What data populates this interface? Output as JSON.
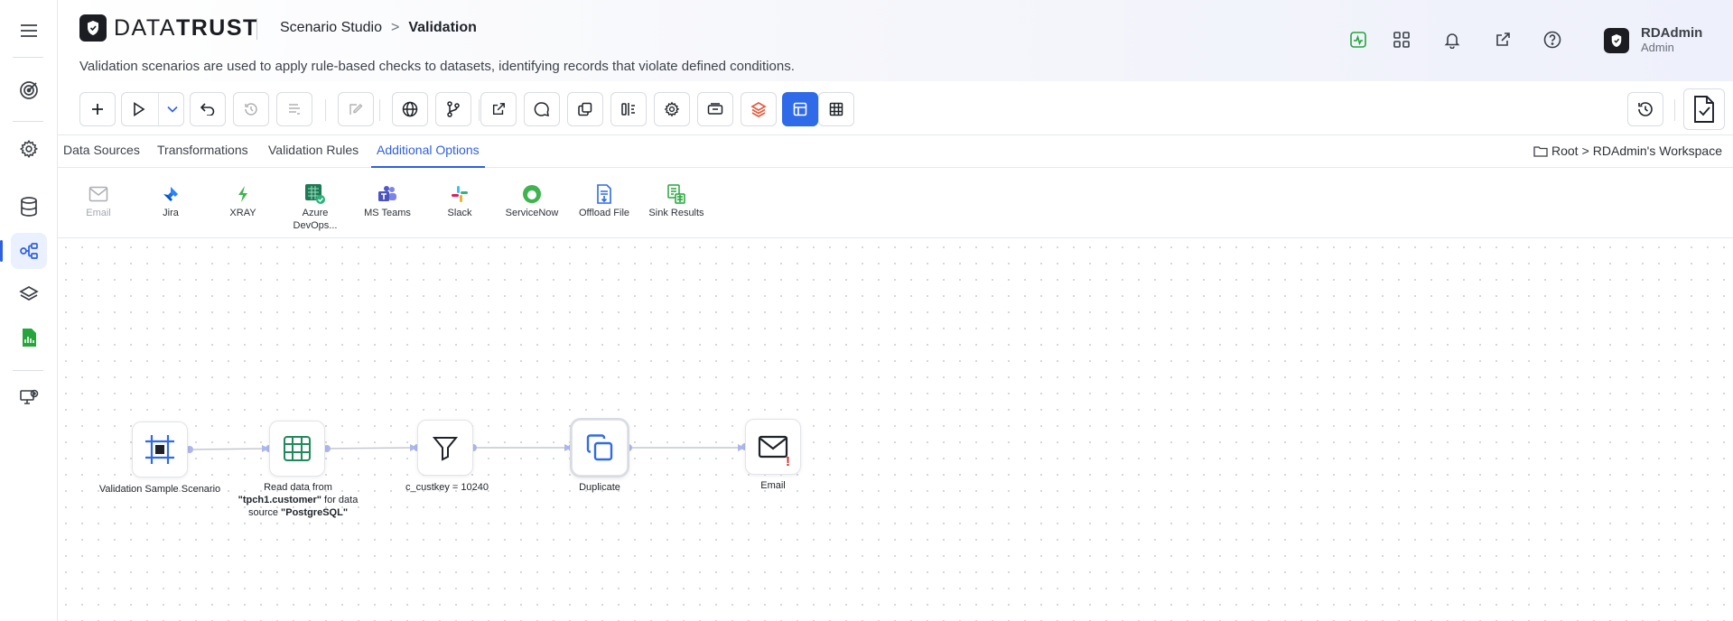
{
  "app": {
    "brand_left": "DATA",
    "brand_right": "TRUST"
  },
  "breadcrumb": {
    "parent": "Scenario Studio",
    "separator": ">",
    "current": "Validation"
  },
  "description": "Validation scenarios are used to apply rule-based checks to datasets, identifying records that violate defined conditions.",
  "header_icons": [
    "activity-icon",
    "grid-icon",
    "bell-icon",
    "external-link-icon",
    "help-icon"
  ],
  "user": {
    "name": "RDAdmin",
    "role": "Admin"
  },
  "tabs": [
    {
      "label": "Data Sources",
      "active": false
    },
    {
      "label": "Transformations",
      "active": false
    },
    {
      "label": "Validation Rules",
      "active": false
    },
    {
      "label": "Additional Options",
      "active": true
    }
  ],
  "workspace": {
    "root": "Root",
    "separator": ">",
    "name": "RDAdmin's Workspace"
  },
  "options": [
    {
      "label": "Email",
      "disabled": true
    },
    {
      "label": "Jira",
      "disabled": false
    },
    {
      "label": "XRAY",
      "disabled": false
    },
    {
      "label": "Azure DevOps...",
      "disabled": false
    },
    {
      "label": "MS Teams",
      "disabled": false
    },
    {
      "label": "Slack",
      "disabled": false
    },
    {
      "label": "ServiceNow",
      "disabled": false
    },
    {
      "label": "Offload File",
      "disabled": false
    },
    {
      "label": "Sink Results",
      "disabled": false
    }
  ],
  "colors": {
    "accent": "#2f6ae8",
    "warning": "#e0262a",
    "brand_dark": "#1b1d22"
  },
  "nodes": {
    "scenario": {
      "label": "Validation Sample Scenario"
    },
    "source": {
      "pre": "Read data from ",
      "table": "\"tpch1.customer\"",
      "mid": " for data source ",
      "ds": "\"PostgreSQL\""
    },
    "filter": {
      "label": "c_custkey = 10240"
    },
    "duplicate": {
      "label": "Duplicate"
    },
    "email": {
      "label": "Email",
      "alert": "!"
    }
  }
}
